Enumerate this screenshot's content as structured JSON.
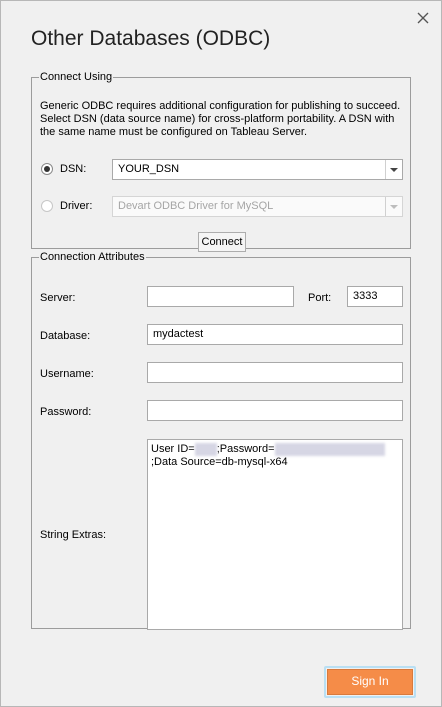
{
  "dialog": {
    "title": "Other Databases (ODBC)"
  },
  "connect_using": {
    "legend": "Connect Using",
    "description": "Generic ODBC requires additional configuration for publishing to succeed. Select DSN (data source name) for cross-platform portability. A DSN with the same name must be configured on Tableau Server.",
    "dsn_label": "DSN:",
    "dsn_value": "YOUR_DSN",
    "driver_label": "Driver:",
    "driver_value": "Devart ODBC Driver for MySQL",
    "connect_button": "Connect"
  },
  "attributes": {
    "legend": "Connection Attributes",
    "server_label": "Server:",
    "server_value": "",
    "port_label": "Port:",
    "port_value": "3333",
    "database_label": "Database:",
    "database_value": "mydactest",
    "username_label": "Username:",
    "username_value": "",
    "password_label": "Password:",
    "password_value": "",
    "string_extras_label": "String Extras:",
    "string_extras": {
      "part1": "User ID=",
      "part2": ";Password=",
      "part3": ";Data Source=db-mysql-x64"
    }
  },
  "footer": {
    "sign_in": "Sign In"
  }
}
